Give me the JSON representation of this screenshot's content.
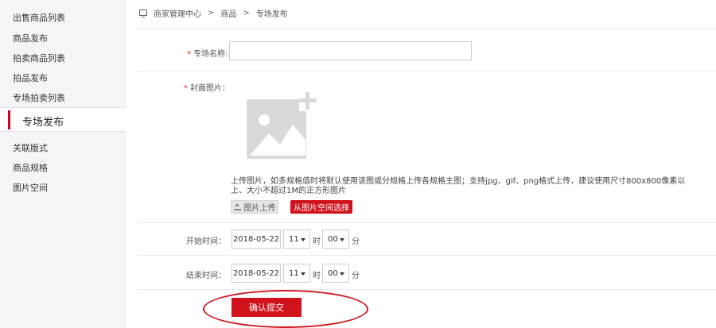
{
  "sidebar": {
    "items_top": [
      "出售商品列表",
      "商品发布",
      "拍卖商品列表",
      "拍品发布",
      "专场拍卖列表"
    ],
    "active": "专场发布",
    "items_bottom": [
      "关联版式",
      "商品规格",
      "图片空间"
    ]
  },
  "breadcrumb": [
    "商家管理中心",
    "商品",
    "专场发布"
  ],
  "form": {
    "name_label": "专场名称:",
    "name_value": "",
    "cover_label": "封面图片：",
    "help_text": "上传图片，如多规格值时将默认使用该图或分规格上传各规格主图；支持jpg、gif、png格式上传，建议使用尺寸800x800像素以上、大小不超过1M的正方形图片",
    "upload_label": "图片上传",
    "choose_label": "从图片空间选择",
    "start_label": "开始时间：",
    "start_date": "2018-05-22",
    "start_hour": "11",
    "start_minute": "00",
    "end_label": "结束时间：",
    "end_date": "2018-05-22",
    "end_hour": "11",
    "end_minute": "00",
    "hour_unit": "时",
    "minute_unit": "分",
    "submit_label": "确认提交",
    "required_mark": "*"
  },
  "colors": {
    "accent": "#d0121b",
    "annotation": "#cf1722"
  }
}
